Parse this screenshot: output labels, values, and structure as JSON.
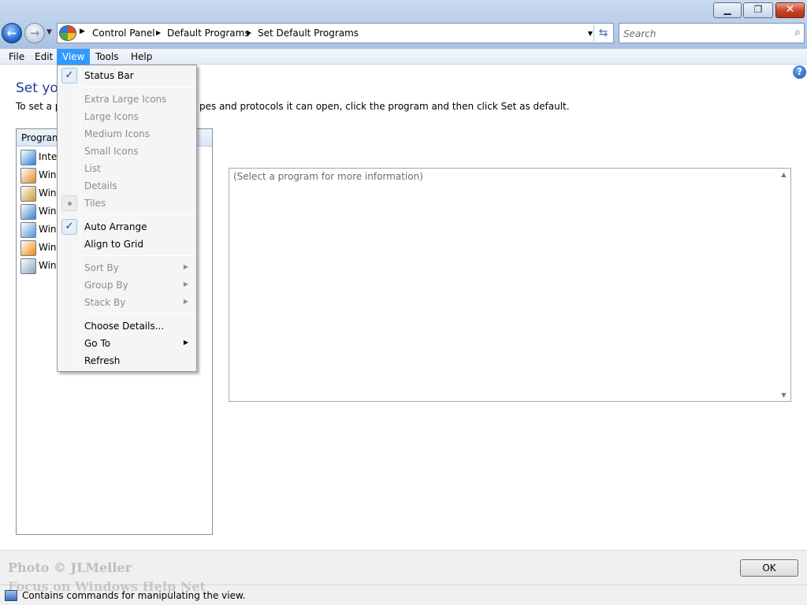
{
  "window": {
    "minimize_glyph": "▁",
    "maximize_glyph": "❐",
    "close_glyph": "✕"
  },
  "nav": {
    "back_glyph": "←",
    "forward_glyph": "→",
    "recent_glyph": "▼"
  },
  "address": {
    "breadcrumbs": [
      "Control Panel",
      "Default Programs",
      "Set Default Programs"
    ],
    "separator": "▶",
    "dropdown_glyph": "▼",
    "refresh_glyph": "⇆"
  },
  "search": {
    "placeholder": "Search",
    "icon_glyph": "⌕"
  },
  "menubar": [
    "File",
    "Edit",
    "View",
    "Tools",
    "Help"
  ],
  "page": {
    "title": "Set you",
    "description": "To set a p",
    "description_tail": "pes and protocols it can open, click the program and then click Set as default.",
    "help_glyph": "?"
  },
  "program_list": {
    "header": "Program",
    "items": [
      {
        "label": "Inter",
        "icon": "internet-explorer-icon",
        "color": "#2f7fd6"
      },
      {
        "label": "Wind",
        "icon": "windows-program-icon",
        "color": "#e08a1e"
      },
      {
        "label": "Wind",
        "icon": "windows-contacts-icon",
        "color": "#c79a2b"
      },
      {
        "label": "Wind",
        "icon": "windows-mail-icon",
        "color": "#3a7fcf"
      },
      {
        "label": "Wind",
        "icon": "windows-calendar-icon",
        "color": "#4f95d9"
      },
      {
        "label": "Wind",
        "icon": "windows-media-player-icon",
        "color": "#f08a00"
      },
      {
        "label": "Wind",
        "icon": "windows-media-center-icon",
        "color": "#8aa2c2"
      }
    ]
  },
  "info_panel": {
    "text": "(Select a program for more information)",
    "scroll_up": "▲",
    "scroll_down": "▼"
  },
  "footer": {
    "ok_label": "OK",
    "watermark_line1": "Photo © JLMeller",
    "watermark_line2": "Focus on Windows Help Net"
  },
  "status": {
    "text": "Contains commands for manipulating the view."
  },
  "view_menu": {
    "items": [
      {
        "label": "Status Bar",
        "state": "checked",
        "enabled": true
      },
      {
        "label": "Extra Large Icons",
        "enabled": false
      },
      {
        "label": "Large Icons",
        "enabled": false
      },
      {
        "label": "Medium Icons",
        "enabled": false
      },
      {
        "label": "Small Icons",
        "enabled": false
      },
      {
        "label": "List",
        "enabled": false
      },
      {
        "label": "Details",
        "enabled": false
      },
      {
        "label": "Tiles",
        "state": "radio",
        "enabled": false
      },
      {
        "label": "Auto Arrange",
        "state": "checked",
        "enabled": true
      },
      {
        "label": "Align to Grid",
        "enabled": true
      },
      {
        "label": "Sort By",
        "submenu": true,
        "enabled": false
      },
      {
        "label": "Group By",
        "submenu": true,
        "enabled": false
      },
      {
        "label": "Stack By",
        "submenu": true,
        "enabled": false
      },
      {
        "label": "Choose Details...",
        "enabled": true
      },
      {
        "label": "Go To",
        "submenu": true,
        "enabled": true
      },
      {
        "label": "Refresh",
        "enabled": true
      }
    ],
    "check_glyph": "✓",
    "submenu_glyph": "▶"
  }
}
